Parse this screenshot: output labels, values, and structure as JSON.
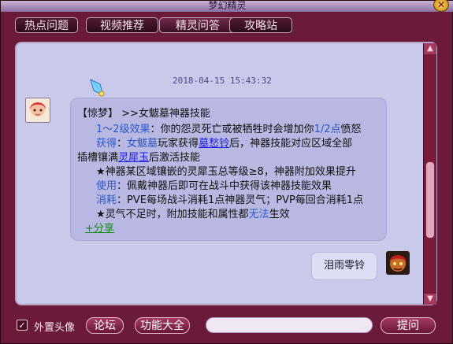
{
  "window": {
    "title": "梦幻精灵"
  },
  "tabs": [
    {
      "label": "热点问题"
    },
    {
      "label": "视频推荐"
    },
    {
      "label": "精灵问答"
    },
    {
      "label": "攻略站"
    }
  ],
  "chat": {
    "timestamp": "2018-04-15 15:43:32",
    "reply": {
      "line1": "【惊梦】  >>女魃墓神器技能",
      "line2_a": "1～2级效果",
      "line2_b": "：你的怨灵死亡或被牺牲时会增加你",
      "line2_c": "1/2点",
      "line2_d": "愤怒",
      "line3_a": "获得",
      "line3_b": "：",
      "line3_c": "女魃墓",
      "line3_d": "玩家获得",
      "line3_e": "墓愁铃",
      "line3_f": "后，神器技能对应区域全部",
      "line4_a": "插槽镶满",
      "line4_b": "灵犀玉",
      "line4_c": "后激活技能",
      "line5": "★神器某区域镶嵌的灵犀玉总等级≥8，神器附加效果提升",
      "line6_a": "使用",
      "line6_b": "：佩戴神器后即可在战斗中获得该神器技能效果",
      "line7_a": "消耗",
      "line7_b": "：PVE每场战斗消耗1点神器灵气；PVP每回合消耗1点",
      "line8_a": "★灵气不足时，附加技能和属性都",
      "line8_b": "无法",
      "line8_c": "生效",
      "share": "+分享"
    },
    "user_message": "泪雨零铃"
  },
  "bottom": {
    "checkbox_label": "外置头像",
    "forum": "论坛",
    "functions": "功能大全",
    "input_placeholder": "",
    "ask": "提问"
  },
  "icons": {
    "close": "close-icon",
    "crystal": "crystal-icon",
    "scroll_up": "scroll-up-icon",
    "scroll_down": "scroll-down-icon"
  },
  "colors": {
    "frame": "#6b1a3a",
    "panel": "#c9c9eb",
    "bubble": "#b8b8e2",
    "blue_text": "#2b58c7",
    "link_text": "#1a1adf",
    "share_text": "#168a16"
  }
}
